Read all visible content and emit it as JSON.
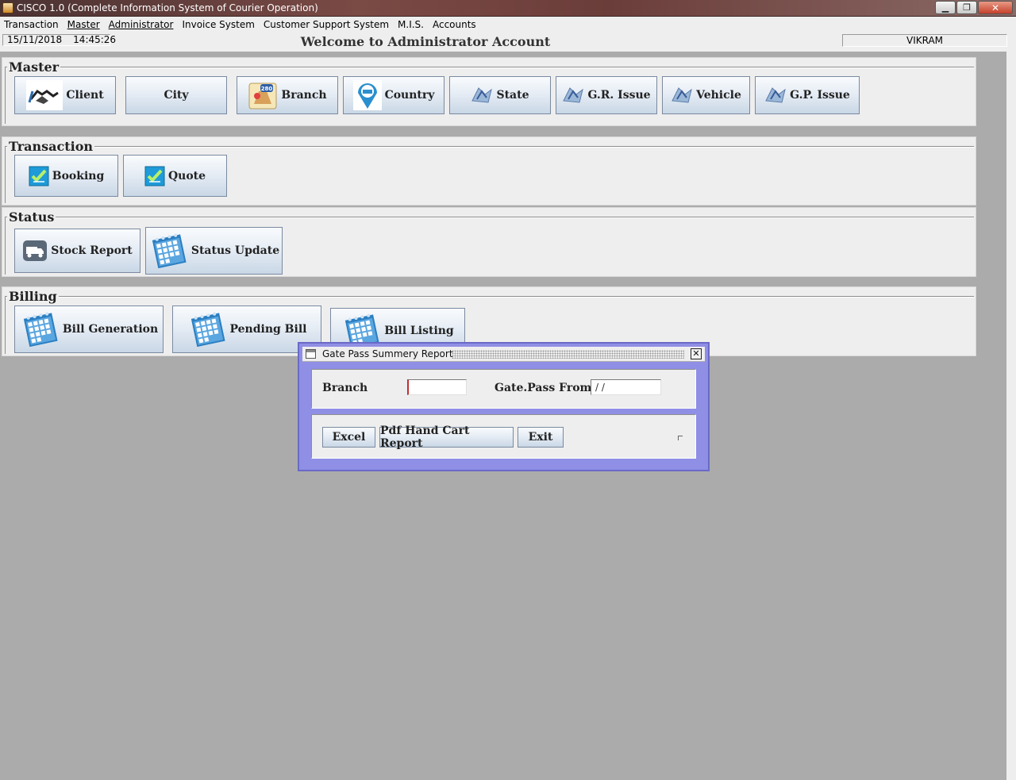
{
  "window": {
    "title": "CISCO 1.0 (Complete Information System of Courier Operation)",
    "controls": [
      "minimize",
      "maximize",
      "close"
    ]
  },
  "menu": [
    {
      "label": "Transaction"
    },
    {
      "label": "Master"
    },
    {
      "label": "Administrator"
    },
    {
      "label": "Invoice System"
    },
    {
      "label": "Customer Support System"
    },
    {
      "label": "M.I.S."
    },
    {
      "label": "Accounts"
    }
  ],
  "status": {
    "date": "15/11/2018",
    "time": "14:45:26",
    "welcome": "Welcome to Administrator Account",
    "user": "VIKRAM"
  },
  "sections": {
    "master": {
      "legend": "Master",
      "buttons": [
        {
          "label": "Client",
          "icon": "handshake-icon"
        },
        {
          "label": "City",
          "icon": ""
        },
        {
          "label": "Branch",
          "icon": "road-sign-icon"
        },
        {
          "label": "Country",
          "icon": "location-pin-icon"
        },
        {
          "label": "State",
          "icon": "map-icon"
        },
        {
          "label": "G.R. Issue",
          "icon": "map-icon"
        },
        {
          "label": "Vehicle",
          "icon": "map-icon"
        },
        {
          "label": "G.P. Issue",
          "icon": "map-icon"
        }
      ]
    },
    "transaction": {
      "legend": "Transaction",
      "buttons": [
        {
          "label": "Booking",
          "icon": "checklist-icon"
        },
        {
          "label": "Quote",
          "icon": "checklist-icon"
        }
      ]
    },
    "status": {
      "legend": "Status",
      "buttons": [
        {
          "label": "Stock Report",
          "icon": "truck-icon"
        },
        {
          "label": "Status Update",
          "icon": "calendar-icon"
        }
      ]
    },
    "billing": {
      "legend": "Billing",
      "buttons": [
        {
          "label": "Bill Generation",
          "icon": "calendar-icon"
        },
        {
          "label": "Pending Bill",
          "icon": "calendar-icon"
        },
        {
          "label": "Bill Listing",
          "icon": "calendar-icon"
        }
      ]
    }
  },
  "dialog": {
    "title": "Gate Pass Summery Report",
    "branch_label": "Branch",
    "branch_value": "",
    "gatepass_label": "Gate.Pass From",
    "gatepass_value": " /  /",
    "buttons": {
      "excel": "Excel",
      "pdf": "Pdf Hand Cart Report",
      "exit": "Exit"
    }
  },
  "colors": {
    "titlebar": "#6b3d3a",
    "panel": "#eeeeee",
    "desktop": "#ababab",
    "dialog_frame": "#8f8fe6",
    "button_gradient_bottom": "#c9d7e6"
  }
}
